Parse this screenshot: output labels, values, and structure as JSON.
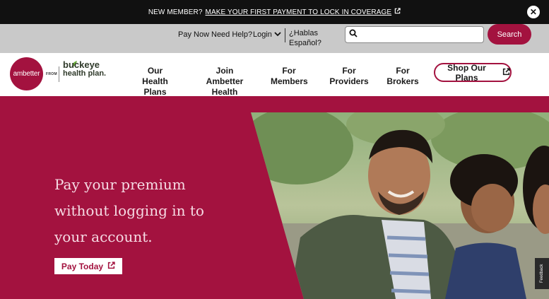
{
  "announcement": {
    "lead": "NEW MEMBER?",
    "link_text": "MAKE YOUR FIRST PAYMENT TO LOCK IN COVERAGE",
    "close_glyph": "✕"
  },
  "utility": {
    "pay_now": "Pay Now",
    "need_help": "Need Help?",
    "login": "Login",
    "spanish": "¿Hablas Español?",
    "search_placeholder": "",
    "search_button": "Search"
  },
  "logo": {
    "ambetter": "ambetter",
    "from": "FROM",
    "buckeye_line1": "buckeye",
    "buckeye_line2": "health plan."
  },
  "nav": {
    "item_1": "Our Health Plans",
    "item_2": "Join Ambetter Health",
    "item_3": "For Members",
    "item_4": "For Providers",
    "item_5": "For Brokers",
    "shop": "Shop Our Plans"
  },
  "hero": {
    "headline": "Pay your premium without logging in to your account.",
    "button": "Pay Today"
  },
  "feedback": "Feedback",
  "colors": {
    "brand": "#a3123f",
    "announce_bg": "#111111",
    "utility_bg": "#c9c9c9"
  },
  "icons": [
    "external-link-icon",
    "close-icon",
    "search-icon",
    "chevron-down-icon",
    "leaf-icon"
  ]
}
